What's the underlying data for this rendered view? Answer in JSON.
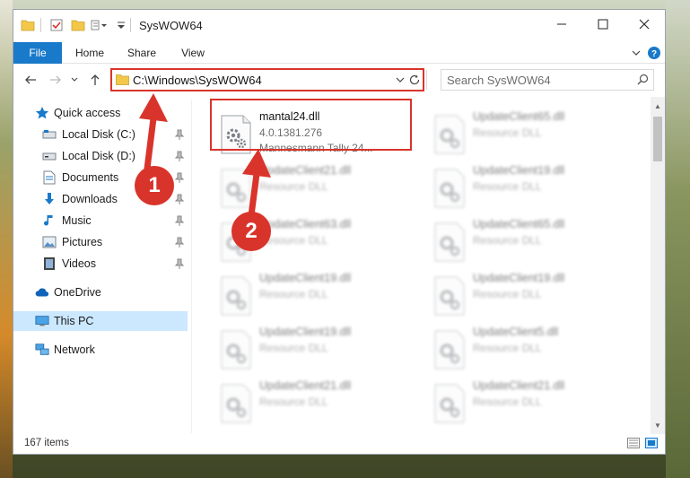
{
  "window": {
    "title": "SysWOW64"
  },
  "ribbon": {
    "tabs": [
      "File",
      "Home",
      "Share",
      "View"
    ]
  },
  "address": {
    "path": "C:\\Windows\\SysWOW64"
  },
  "search": {
    "placeholder": "Search SysWOW64"
  },
  "sidebar": {
    "quick_access": "Quick access",
    "items": [
      {
        "label": "Local Disk (C:)",
        "icon": "drive-icon"
      },
      {
        "label": "Local Disk (D:)",
        "icon": "drive-icon"
      },
      {
        "label": "Documents",
        "icon": "documents-icon"
      },
      {
        "label": "Downloads",
        "icon": "downloads-icon"
      },
      {
        "label": "Music",
        "icon": "music-icon"
      },
      {
        "label": "Pictures",
        "icon": "pictures-icon"
      },
      {
        "label": "Videos",
        "icon": "videos-icon"
      }
    ],
    "onedrive": "OneDrive",
    "this_pc": "This PC",
    "network": "Network"
  },
  "files": {
    "left": [
      {
        "name": "mantal24.dll",
        "line2": "4.0.1381.276",
        "line3": "Mannesmann Tally 24..."
      },
      {
        "name": "UpdateClient21.dll",
        "line2": "Resource DLL"
      },
      {
        "name": "UpdateClient63.dll",
        "line2": "Resource DLL"
      },
      {
        "name": "UpdateClient19.dll",
        "line2": "Resource DLL"
      },
      {
        "name": "UpdateClient19.dll",
        "line2": "Resource DLL"
      },
      {
        "name": "UpdateClient21.dll",
        "line2": "Resource DLL"
      }
    ],
    "right": [
      {
        "name": "UpdateClient65.dll",
        "line2": "Resource DLL"
      },
      {
        "name": "UpdateClient19.dll",
        "line2": "Resource DLL"
      },
      {
        "name": "UpdateClient65.dll",
        "line2": "Resource DLL"
      },
      {
        "name": "UpdateClient19.dll",
        "line2": "Resource DLL"
      },
      {
        "name": "UpdateClient5.dll",
        "line2": "Resource DLL"
      },
      {
        "name": "UpdateClient21.dll",
        "line2": "Resource DLL"
      }
    ]
  },
  "status": {
    "item_count": "167 items"
  },
  "annotations": {
    "step1": "1",
    "step2": "2",
    "color": "#d9342b"
  },
  "colors": {
    "accent": "#1979ca",
    "selection": "#cce8ff"
  }
}
